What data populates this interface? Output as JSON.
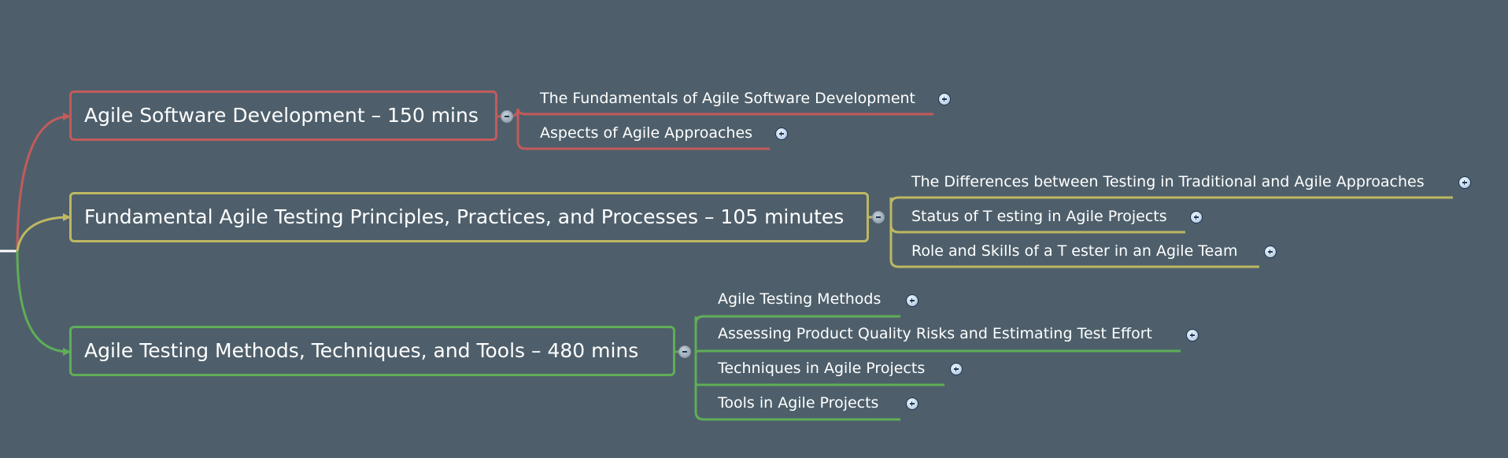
{
  "colors": {
    "background": "#4e5f6b",
    "branch_red": "#c25b5b",
    "branch_yellow": "#bdb862",
    "branch_green": "#5fae57",
    "text": "#ffffff"
  },
  "topics": [
    {
      "label": "Agile Software Development – 150 mins",
      "subtopics": [
        "The Fundamentals of Agile Software Development",
        "Aspects of Agile Approaches"
      ]
    },
    {
      "label": "Fundamental Agile Testing Principles, Practices, and Processes – 105 minutes",
      "subtopics": [
        "The Differences between Testing in Traditional and Agile Approaches",
        "Status of T esting in Agile Projects",
        "Role and Skills of a T ester in an Agile Team"
      ]
    },
    {
      "label": "Agile Testing Methods, Techniques, and Tools – 480 mins",
      "subtopics": [
        "Agile Testing Methods",
        "Assessing Product Quality Risks and Estimating Test Effort",
        "Techniques in Agile Projects",
        "Tools in Agile Projects"
      ]
    }
  ],
  "icons": {
    "collapse": "minus-circle-icon",
    "expand": "plus-circle-icon"
  }
}
